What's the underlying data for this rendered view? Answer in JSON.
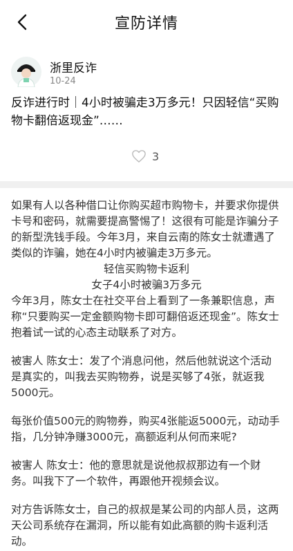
{
  "header": {
    "title": "宣防详情",
    "back_icon": "chevron-left-icon"
  },
  "post": {
    "author": "浙里反诈",
    "date": "10-24",
    "title": "反诈进行时｜4小时被骗走3万多元！只因轻信“买购物卡翻倍返现金”……",
    "like_count": "3",
    "like_icon": "heart-outline-icon"
  },
  "article": {
    "p1": "如果有人以各种借口让你购买超市购物卡，并要求你提供卡号和密码，就需要提高警惕了！这很有可能是诈骗分子的新型洗钱手段。今年3月，来自云南的陈女士就遭遇了类似的诈骗，她在4小时内被骗走3万多元。",
    "subtitle1": "轻信买购物卡返利",
    "subtitle2": "女子4小时被骗3万多元",
    "p2": "今年3月，陈女士在社交平台上看到了一条兼职信息，声称“只要购买一定金额购物卡即可翻倍返还现金”。陈女士抱着试一试的心态主动联系了对方。",
    "p3": "被害人 陈女士：发了个消息问他，然后他就说这个活动是真实的，叫我去买购物券，说是买够了4张，就返我5000元。",
    "p4": "每张价值500元的购物券，购买4张能返5000元，动动手指，几分钟净赚3000元，高额返利从何而来呢?",
    "p5": "被害人 陈女士：他的意思就是说他叔叔那边有一个财务。叫我下了一个软件，再跟他开视频会议。",
    "p6": "对方告诉陈女士，自己的叔叔是某公司的内部人员，这两天公司系统存在漏洞，所以能有如此高额的购卡返利活动。"
  }
}
